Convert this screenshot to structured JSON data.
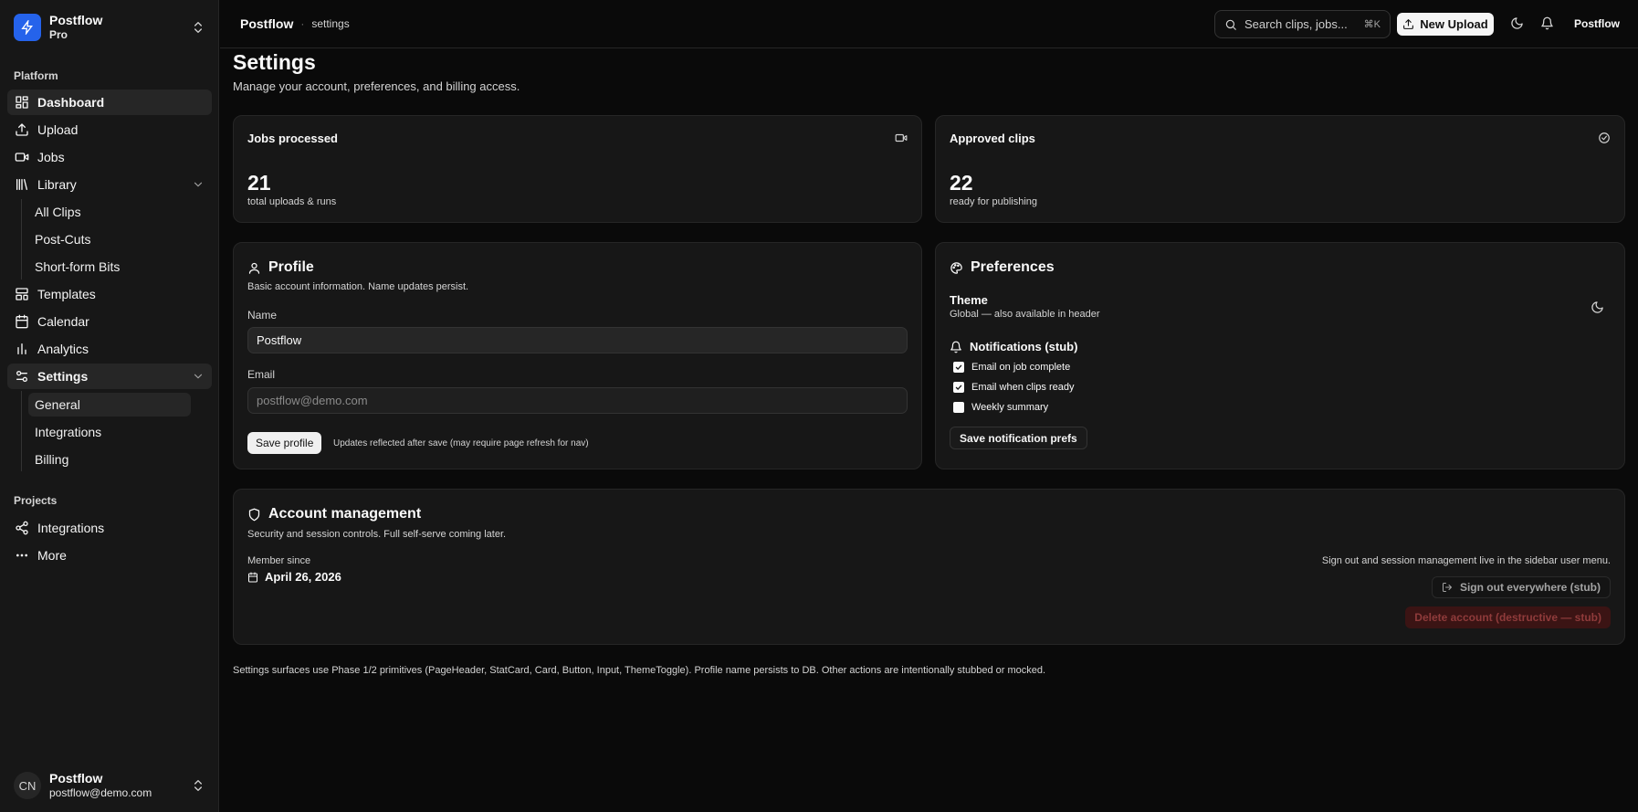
{
  "sidebar": {
    "org": {
      "name": "Postflow",
      "plan": "Pro"
    },
    "platform_label": "Platform",
    "items": {
      "dashboard": "Dashboard",
      "upload": "Upload",
      "jobs": "Jobs",
      "library": "Library",
      "library_sub": [
        "All Clips",
        "Post-Cuts",
        "Short-form Bits"
      ],
      "templates": "Templates",
      "calendar": "Calendar",
      "analytics": "Analytics",
      "settings": "Settings",
      "settings_sub": [
        "General",
        "Integrations",
        "Billing"
      ]
    },
    "projects_label": "Projects",
    "projects": {
      "integrations": "Integrations",
      "more": "More"
    },
    "user": {
      "initials": "CN",
      "name": "Postflow",
      "email": "postflow@demo.com"
    }
  },
  "header": {
    "app": "Postflow",
    "separator": "·",
    "page": "settings",
    "search_placeholder": "Search clips, jobs...",
    "search_kbd": "⌘K",
    "new_upload": "New Upload",
    "user": "Postflow"
  },
  "page": {
    "title": "Settings",
    "subtitle": "Manage your account, preferences, and billing access."
  },
  "stats": {
    "jobs": {
      "label": "Jobs processed",
      "value": "21",
      "sub": "total uploads & runs"
    },
    "approved": {
      "label": "Approved clips",
      "value": "22",
      "sub": "ready for publishing"
    }
  },
  "profile": {
    "title": "Profile",
    "desc": "Basic account information. Name updates persist.",
    "name_label": "Name",
    "name_value": "Postflow",
    "email_label": "Email",
    "email_value": "postflow@demo.com",
    "save": "Save profile",
    "hint": "Updates reflected after save (may require page refresh for nav)"
  },
  "preferences": {
    "title": "Preferences",
    "theme_title": "Theme",
    "theme_sub": "Global — also available in header",
    "notif_title": "Notifications (stub)",
    "checks": [
      {
        "label": "Email on job complete",
        "checked": true
      },
      {
        "label": "Email when clips ready",
        "checked": true
      },
      {
        "label": "Weekly summary",
        "checked": false
      }
    ],
    "save": "Save notification prefs"
  },
  "account": {
    "title": "Account management",
    "desc": "Security and session controls. Full self-serve coming later.",
    "member_label": "Member since",
    "member_date": "April 26, 2026",
    "note": "Sign out and session management live in the sidebar user menu.",
    "signout": "Sign out everywhere (stub)",
    "delete": "Delete account (destructive — stub)"
  },
  "footnote": "Settings surfaces use Phase 1/2 primitives (PageHeader, StatCard, Card, Button, Input, ThemeToggle). Profile name persists to DB. Other actions are intentionally stubbed or mocked.",
  "colors": {
    "accent": "#2563eb",
    "background": "#0a0a0a",
    "card": "#171717",
    "danger_bg": "#3b1414"
  }
}
